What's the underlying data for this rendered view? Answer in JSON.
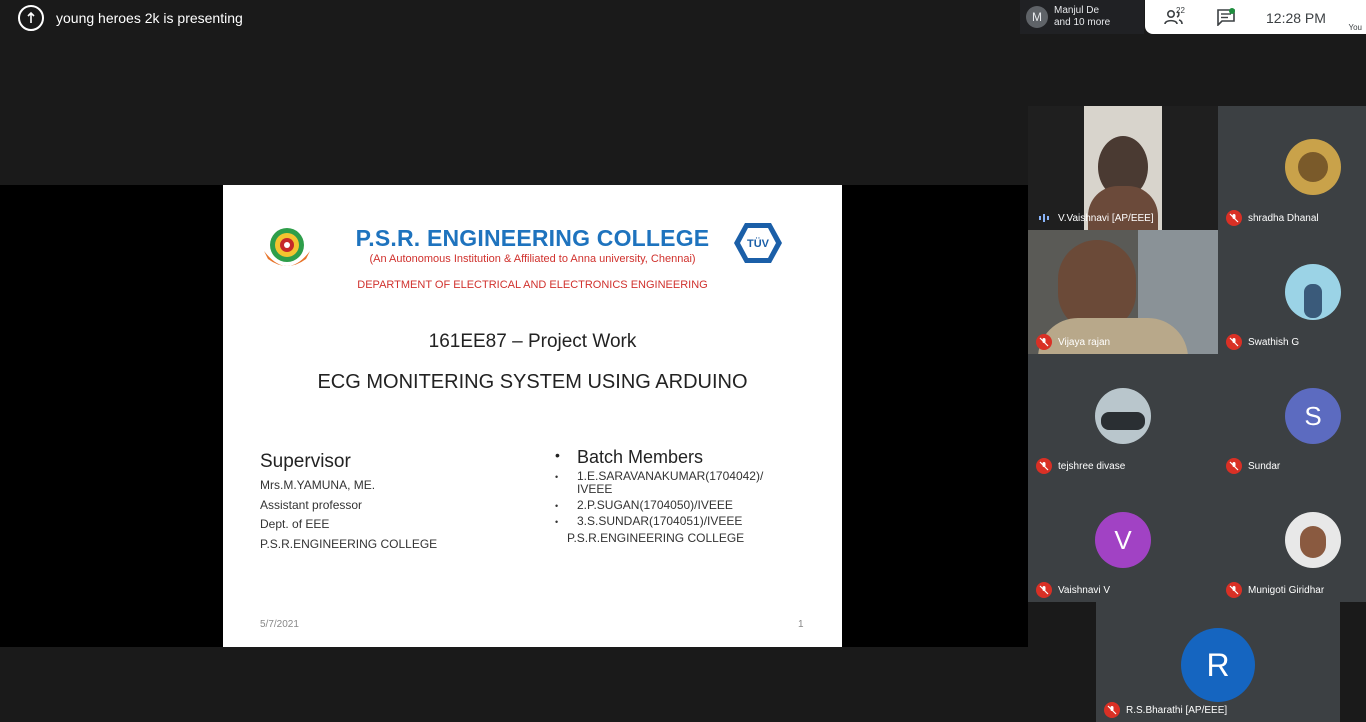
{
  "presenter": {
    "text": "young heroes 2k is presenting",
    "icon": "present-screen-icon"
  },
  "people_chip": {
    "avatar_letter": "M",
    "line1": "Manjul De",
    "line2": "and 10 more"
  },
  "top_bar": {
    "participant_count": "22",
    "time": "12:28 PM",
    "you_label": "You",
    "chat_dot_color": "#1e8e3e"
  },
  "slide": {
    "college_name": "P.S.R. ENGINEERING COLLEGE",
    "college_sub": "(An Autonomous Institution & Affiliated to Anna university, Chennai)",
    "department": "DEPARTMENT OF ELECTRICAL AND ELECTRONICS ENGINEERING",
    "project_code": "161EE87 – Project Work",
    "project_title": "ECG MONITERING SYSTEM USING ARDUINO",
    "supervisor": {
      "heading": "Supervisor",
      "lines": [
        "Mrs.M.YAMUNA, ME.",
        "Assistant professor",
        "Dept. of EEE",
        "P.S.R.ENGINEERING COLLEGE"
      ]
    },
    "batch": {
      "heading": "Batch Members",
      "members": [
        "1.E.SARAVANAKUMAR(1704042)/ IVEEE",
        "2.P.SUGAN(1704050)/IVEEE",
        "3.S.SUNDAR(1704051)/IVEEE"
      ],
      "college": "P.S.R.ENGINEERING COLLEGE"
    },
    "date": "5/7/2021",
    "page": "1",
    "logo_right_text": "TÜV"
  },
  "participants": [
    {
      "name": "V.Vaishnavi [AP/EEE]",
      "type": "video",
      "mic": "on"
    },
    {
      "name": "shradha Dhanal",
      "type": "photo",
      "mic": "off"
    },
    {
      "name": "Vijaya rajan",
      "type": "video",
      "mic": "off"
    },
    {
      "name": "Swathish G",
      "type": "photo",
      "mic": "off"
    },
    {
      "name": "tejshree divase",
      "type": "photo",
      "mic": "off"
    },
    {
      "name": "Sundar",
      "type": "letter",
      "letter": "S",
      "color": "#5c6bc0",
      "mic": "off"
    },
    {
      "name": "Vaishnavi V",
      "type": "letter",
      "letter": "V",
      "color": "#a142c4",
      "mic": "off"
    },
    {
      "name": "Munigoti Giridhar",
      "type": "photo",
      "mic": "off"
    },
    {
      "name": "R.S.Bharathi [AP/EEE]",
      "type": "letter",
      "letter": "R",
      "color": "#1565c0",
      "mic": "off"
    }
  ]
}
